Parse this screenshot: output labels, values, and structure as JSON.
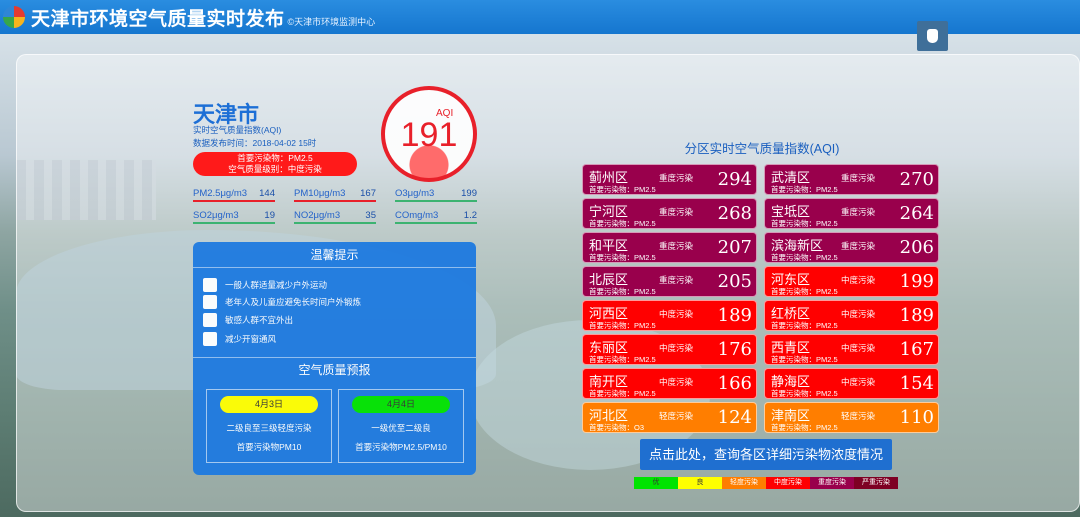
{
  "header": {
    "title": "天津市环境空气质量实时发布",
    "subtitle": "©天津市环境监测中心"
  },
  "city": {
    "name": "天津市",
    "aqi_caption": "实时空气质量指数(AQI)",
    "publish_time": "数据发布时间：2018-04-02 15时",
    "primary_pollutant": "首要污染物：PM2.5",
    "quality_level": "空气质量级别：中度污染",
    "aqi_label": "AQI",
    "aqi_value": "191",
    "aqi_fraction": 0.38
  },
  "pollutants": [
    {
      "name": "PM2.5μg/m3",
      "value": "144",
      "color": "#e8202a"
    },
    {
      "name": "PM10μg/m3",
      "value": "167",
      "color": "#e8202a"
    },
    {
      "name": "O3μg/m3",
      "value": "199",
      "color": "#3cb371"
    },
    {
      "name": "SO2μg/m3",
      "value": "19",
      "color": "#3cb371"
    },
    {
      "name": "NO2μg/m3",
      "value": "35",
      "color": "#3cb371"
    },
    {
      "name": "COmg/m3",
      "value": "1.2",
      "color": "#3cb371"
    }
  ],
  "tips": {
    "title": "温馨提示",
    "items": [
      {
        "text": "一般人群适量减少户外运动",
        "icon": "running-person-icon"
      },
      {
        "text": "老年人及儿童应避免长时间户外锻炼",
        "icon": "walking-person-icon"
      },
      {
        "text": "敏感人群不宜外出",
        "icon": "mask-face-icon"
      },
      {
        "text": "减少开窗通风",
        "icon": "window-icon"
      }
    ]
  },
  "forecast": {
    "title": "空气质量预报",
    "days": [
      {
        "date": "4月3日",
        "level": "二级良至三级轻度污染",
        "pollutant": "首要污染物PM10",
        "color": "#ffff00"
      },
      {
        "date": "4月4日",
        "level": "一级优至二级良",
        "pollutant": "首要污染物PM2.5/PM10",
        "color": "#00e400"
      }
    ]
  },
  "districts": {
    "title": "分区实时空气质量指数(AQI)",
    "items": [
      {
        "name": "蓟州区",
        "level": "重度污染",
        "primary": "首要污染物：PM2.5",
        "value": "294",
        "color": "#99004c"
      },
      {
        "name": "武清区",
        "level": "重度污染",
        "primary": "首要污染物：PM2.5",
        "value": "270",
        "color": "#99004c"
      },
      {
        "name": "宁河区",
        "level": "重度污染",
        "primary": "首要污染物：PM2.5",
        "value": "268",
        "color": "#99004c"
      },
      {
        "name": "宝坻区",
        "level": "重度污染",
        "primary": "首要污染物：PM2.5",
        "value": "264",
        "color": "#99004c"
      },
      {
        "name": "和平区",
        "level": "重度污染",
        "primary": "首要污染物：PM2.5",
        "value": "207",
        "color": "#99004c"
      },
      {
        "name": "滨海新区",
        "level": "重度污染",
        "primary": "首要污染物：PM2.5",
        "value": "206",
        "color": "#99004c"
      },
      {
        "name": "北辰区",
        "level": "重度污染",
        "primary": "首要污染物：PM2.5",
        "value": "205",
        "color": "#99004c"
      },
      {
        "name": "河东区",
        "level": "中度污染",
        "primary": "首要污染物：PM2.5",
        "value": "199",
        "color": "#ff0000"
      },
      {
        "name": "河西区",
        "level": "中度污染",
        "primary": "首要污染物：PM2.5",
        "value": "189",
        "color": "#ff0000"
      },
      {
        "name": "红桥区",
        "level": "中度污染",
        "primary": "首要污染物：PM2.5",
        "value": "189",
        "color": "#ff0000"
      },
      {
        "name": "东丽区",
        "level": "中度污染",
        "primary": "首要污染物：PM2.5",
        "value": "176",
        "color": "#ff0000"
      },
      {
        "name": "西青区",
        "level": "中度污染",
        "primary": "首要污染物：PM2.5",
        "value": "167",
        "color": "#ff0000"
      },
      {
        "name": "南开区",
        "level": "中度污染",
        "primary": "首要污染物：PM2.5",
        "value": "166",
        "color": "#ff0000"
      },
      {
        "name": "静海区",
        "level": "中度污染",
        "primary": "首要污染物：PM2.5",
        "value": "154",
        "color": "#ff0000"
      },
      {
        "name": "河北区",
        "level": "轻度污染",
        "primary": "首要污染物：O3",
        "value": "124",
        "color": "#ff7e00"
      },
      {
        "name": "津南区",
        "level": "轻度污染",
        "primary": "首要污染物：PM2.5",
        "value": "110",
        "color": "#ff7e00"
      }
    ]
  },
  "query_button": "点击此处，查询各区详细污染物浓度情况",
  "legend": [
    {
      "label": "优",
      "color": "#00e400"
    },
    {
      "label": "良",
      "color": "#ffff00"
    },
    {
      "label": "轻度污染",
      "color": "#ff7e00"
    },
    {
      "label": "中度污染",
      "color": "#ff0000"
    },
    {
      "label": "重度污染",
      "color": "#99004c"
    },
    {
      "label": "严重污染",
      "color": "#7e0023"
    }
  ]
}
